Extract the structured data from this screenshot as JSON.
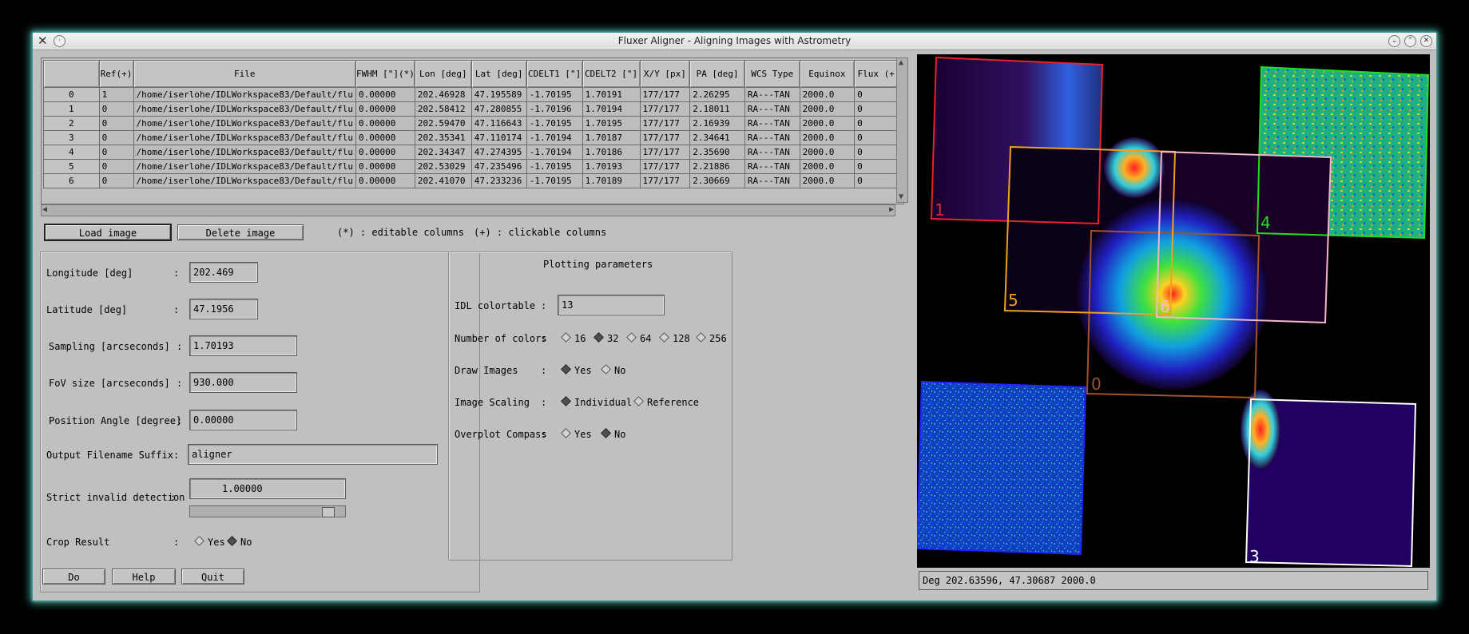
{
  "window": {
    "title": "Fluxer Aligner - Aligning Images with Astrometry"
  },
  "table": {
    "headers": [
      "",
      "Ref(+)",
      "File",
      "FWHM [\"](*)",
      "Lon [deg]",
      "Lat [deg]",
      "CDELT1 [\"]",
      "CDELT2 [\"]",
      "X/Y [px]",
      "PA [deg]",
      "WCS Type",
      "Equinox",
      "Flux (+)"
    ],
    "rows": [
      [
        "0",
        "1",
        "/home/iserlohe/IDLWorkspace83/Default/flu",
        "0.00000",
        "202.46928",
        "47.195589",
        "-1.70195",
        "1.70191",
        "177/177",
        "2.26295",
        "RA---TAN",
        "2000.0",
        "0"
      ],
      [
        "1",
        "0",
        "/home/iserlohe/IDLWorkspace83/Default/flu",
        "0.00000",
        "202.58412",
        "47.280855",
        "-1.70196",
        "1.70194",
        "177/177",
        "2.18011",
        "RA---TAN",
        "2000.0",
        "0"
      ],
      [
        "2",
        "0",
        "/home/iserlohe/IDLWorkspace83/Default/flu",
        "0.00000",
        "202.59470",
        "47.116643",
        "-1.70195",
        "1.70195",
        "177/177",
        "2.16939",
        "RA---TAN",
        "2000.0",
        "0"
      ],
      [
        "3",
        "0",
        "/home/iserlohe/IDLWorkspace83/Default/flu",
        "0.00000",
        "202.35341",
        "47.110174",
        "-1.70194",
        "1.70187",
        "177/177",
        "2.34641",
        "RA---TAN",
        "2000.0",
        "0"
      ],
      [
        "4",
        "0",
        "/home/iserlohe/IDLWorkspace83/Default/flu",
        "0.00000",
        "202.34347",
        "47.274395",
        "-1.70194",
        "1.70186",
        "177/177",
        "2.35690",
        "RA---TAN",
        "2000.0",
        "0"
      ],
      [
        "5",
        "0",
        "/home/iserlohe/IDLWorkspace83/Default/flu",
        "0.00000",
        "202.53029",
        "47.235496",
        "-1.70195",
        "1.70193",
        "177/177",
        "2.21886",
        "RA---TAN",
        "2000.0",
        "0"
      ],
      [
        "6",
        "0",
        "/home/iserlohe/IDLWorkspace83/Default/flu",
        "0.00000",
        "202.41070",
        "47.233236",
        "-1.70195",
        "1.70189",
        "177/177",
        "2.30669",
        "RA---TAN",
        "2000.0",
        "0"
      ]
    ]
  },
  "actions": {
    "load_image": "Load image",
    "delete_image": "Delete image",
    "editable_note": "(*) : editable columns",
    "clickable_note": "(+) : clickable columns"
  },
  "params": {
    "longitude": {
      "label": "Longitude [deg]",
      "value": "202.469"
    },
    "latitude": {
      "label": "Latitude [deg]",
      "value": "47.1956"
    },
    "sampling": {
      "label": "Sampling [arcseconds]",
      "value": "1.70193"
    },
    "fov": {
      "label": "FoV size [arcseconds]",
      "value": "930.000"
    },
    "position_angle": {
      "label": "Position Angle [degree]",
      "value": "0.00000"
    },
    "suffix": {
      "label": "Output Filename Suffix",
      "value": "aligner"
    },
    "strict": {
      "label": "Strict invalid detection",
      "value": "1.00000"
    },
    "crop": {
      "label": "Crop Result",
      "options": [
        "Yes",
        "No"
      ],
      "selected": "No"
    },
    "colon": ":"
  },
  "plotting": {
    "title": "Plotting parameters",
    "colortable": {
      "label": "IDL colortable",
      "value": "13"
    },
    "num_colors": {
      "label": "Number of colors",
      "options": [
        "16",
        "32",
        "64",
        "128",
        "256"
      ],
      "selected": "32"
    },
    "draw_images": {
      "label": "Draw Images",
      "options": [
        "Yes",
        "No"
      ],
      "selected": "Yes"
    },
    "image_scaling": {
      "label": "Image Scaling",
      "options": [
        "Individual",
        "Reference"
      ],
      "selected": "Individual"
    },
    "overplot_compass": {
      "label": "Overplot Compass",
      "options": [
        "Yes",
        "No"
      ],
      "selected": "No"
    }
  },
  "bottom_buttons": {
    "do": "Do",
    "help": "Help",
    "quit": "Quit"
  },
  "image_labels": [
    "0",
    "1",
    "3",
    "4",
    "5",
    "6"
  ],
  "status_text": "Deg 202.63596, 47.30687   2000.0",
  "colors": {
    "frame0": "#a0522d",
    "frame1": "#e8232d",
    "frame2": "#2222ff",
    "frame3": "#ffffff",
    "frame4": "#22dd22",
    "frame5": "#f0a020",
    "frame6": "#f4b8c8"
  }
}
